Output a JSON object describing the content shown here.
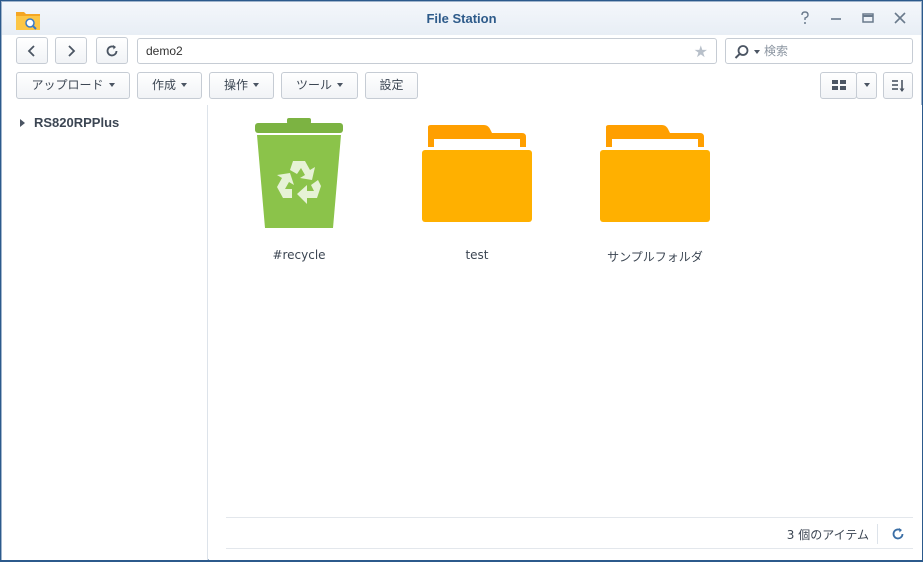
{
  "window": {
    "title": "File Station",
    "app_icon": "file-station-folder-magnifier-icon",
    "controls": [
      "help-icon",
      "minimize-icon",
      "maximize-icon",
      "close-icon"
    ]
  },
  "nav": {
    "back_icon": "chevron-left-icon",
    "forward_icon": "chevron-right-icon",
    "refresh_icon": "refresh-icon"
  },
  "pathbar": {
    "value": "demo2",
    "favorite_icon": "star-icon"
  },
  "search": {
    "placeholder": "検索",
    "icon": "search-icon"
  },
  "toolbar": {
    "upload_label": "アップロード",
    "create_label": "作成",
    "action_label": "操作",
    "tools_label": "ツール",
    "settings_label": "設定",
    "view_icon": "grid-view-icon",
    "sort_icon": "sort-icon"
  },
  "sidebar": {
    "items": [
      {
        "label": "RS820RPPlus"
      }
    ]
  },
  "files": [
    {
      "name": "#recycle",
      "icon": "recycle-bin-icon"
    },
    {
      "name": "test",
      "icon": "folder-icon"
    },
    {
      "name": "サンプルフォルダ",
      "icon": "folder-icon"
    }
  ],
  "status": {
    "count_text": "3 個のアイテム"
  },
  "colors": {
    "title": "#2e5b8a",
    "folder": "#ffb000",
    "folder_tab": "#ff9f00",
    "recycle": "#8bc34a",
    "border_frame": "#2c5a8c"
  }
}
